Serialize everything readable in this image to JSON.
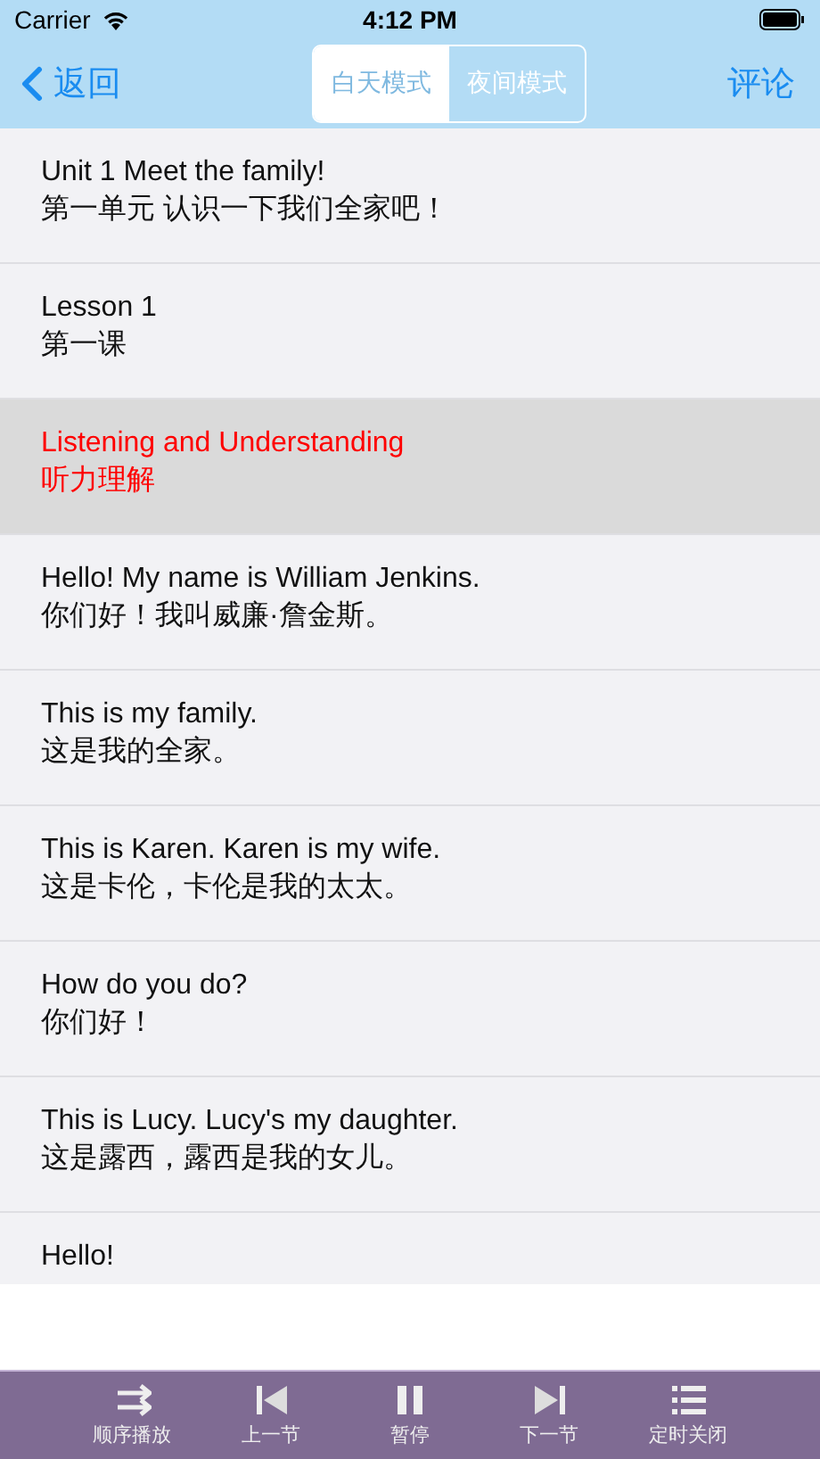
{
  "status_bar": {
    "carrier": "Carrier",
    "time": "4:12 PM"
  },
  "nav": {
    "back": "返回",
    "modes": [
      {
        "label": "白天模式",
        "selected": true
      },
      {
        "label": "夜间模式",
        "selected": false
      }
    ],
    "action": "评论"
  },
  "rows": [
    {
      "en": "Unit 1 Meet the family!",
      "zh": "第一单元 认识一下我们全家吧！",
      "selected": false
    },
    {
      "en": "Lesson 1",
      "zh": "第一课",
      "selected": false
    },
    {
      "en": "Listening and Understanding",
      "zh": "听力理解",
      "selected": true
    },
    {
      "en": "Hello! My name is William Jenkins.",
      "zh": "你们好！我叫威廉·詹金斯。",
      "selected": false
    },
    {
      "en": "This is my family.",
      "zh": "这是我的全家。",
      "selected": false
    },
    {
      "en": "This is Karen. Karen is my wife.",
      "zh": "这是卡伦，卡伦是我的太太。",
      "selected": false
    },
    {
      "en": "How do you do?",
      "zh": "你们好！",
      "selected": false
    },
    {
      "en": "This is Lucy. Lucy's my daughter.",
      "zh": "这是露西，露西是我的女儿。",
      "selected": false
    },
    {
      "en": "Hello!",
      "selected": false
    }
  ],
  "toolbar": [
    {
      "kind": "shuffle",
      "label": "顺序播放"
    },
    {
      "kind": "prev",
      "label": "上一节"
    },
    {
      "kind": "pause",
      "label": "暂停"
    },
    {
      "kind": "next",
      "label": "下一节"
    },
    {
      "kind": "list",
      "label": "定时关闭"
    }
  ]
}
